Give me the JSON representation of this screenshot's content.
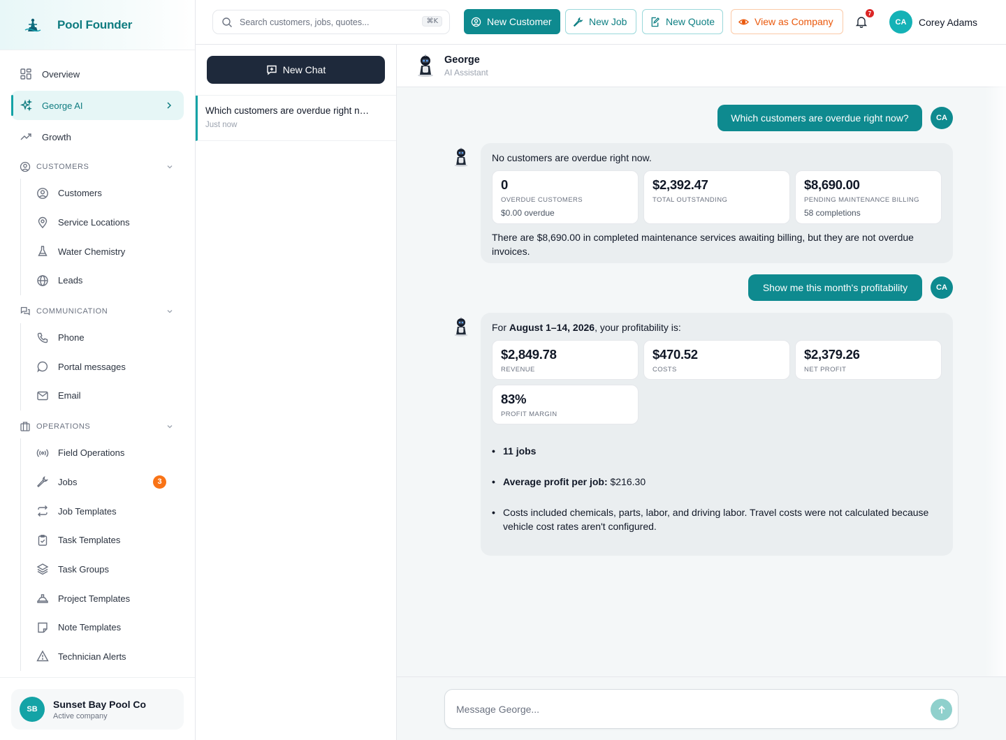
{
  "brand": {
    "name": "Pool Founder"
  },
  "sidebar": {
    "top_items": [
      {
        "label": "Overview",
        "icon": "grid-icon"
      },
      {
        "label": "George AI",
        "icon": "sparkles-icon",
        "active": true
      },
      {
        "label": "Growth",
        "icon": "trending-up-icon"
      }
    ],
    "sections": [
      {
        "title": "CUSTOMERS",
        "items": [
          {
            "label": "Customers"
          },
          {
            "label": "Service Locations"
          },
          {
            "label": "Water Chemistry"
          },
          {
            "label": "Leads"
          }
        ]
      },
      {
        "title": "COMMUNICATION",
        "items": [
          {
            "label": "Phone"
          },
          {
            "label": "Portal messages"
          },
          {
            "label": "Email"
          }
        ]
      },
      {
        "title": "OPERATIONS",
        "items": [
          {
            "label": "Field Operations"
          },
          {
            "label": "Jobs",
            "badge": "3"
          },
          {
            "label": "Job Templates"
          },
          {
            "label": "Task Templates"
          },
          {
            "label": "Task Groups"
          },
          {
            "label": "Project Templates"
          },
          {
            "label": "Note Templates"
          },
          {
            "label": "Technician Alerts"
          }
        ]
      }
    ],
    "company": {
      "initials": "SB",
      "name": "Sunset Bay Pool Co",
      "status": "Active company"
    }
  },
  "topbar": {
    "search_placeholder": "Search customers, jobs, quotes...",
    "search_shortcut": "⌘K",
    "new_customer": "New Customer",
    "new_job": "New Job",
    "new_quote": "New Quote",
    "view_as_company": "View as Company",
    "notification_count": "7",
    "user": {
      "initials": "CA",
      "name": "Corey Adams"
    }
  },
  "chatlist": {
    "new_chat": "New Chat",
    "conversations": [
      {
        "title": "Which customers are overdue right now?",
        "time": "Just now"
      }
    ]
  },
  "chat": {
    "assistant_name": "George",
    "assistant_role": "AI Assistant",
    "user_initials": "CA",
    "messages": [
      {
        "role": "user",
        "text": "Which customers are overdue right now?"
      },
      {
        "role": "assistant",
        "lead": "No customers are overdue right now.",
        "cards": [
          {
            "value": "0",
            "label": "OVERDUE CUSTOMERS",
            "sub": "$0.00 overdue"
          },
          {
            "value": "$2,392.47",
            "label": "TOTAL OUTSTANDING",
            "sub": ""
          },
          {
            "value": "$8,690.00",
            "label": "PENDING MAINTENANCE BILLING",
            "sub": "58 completions"
          }
        ],
        "text": "There are $8,690.00 in completed maintenance services awaiting billing, but they are not overdue invoices."
      },
      {
        "role": "user",
        "text": "Show me this month's profitability"
      },
      {
        "role": "assistant",
        "lead_prefix": "For ",
        "lead_bold": "August 1–14, 2026",
        "lead_suffix": ", your profitability is:",
        "cards": [
          {
            "value": "$2,849.78",
            "label": "REVENUE"
          },
          {
            "value": "$470.52",
            "label": "COSTS"
          },
          {
            "value": "$2,379.26",
            "label": "NET PROFIT"
          },
          {
            "value": "83%",
            "label": "PROFIT MARGIN"
          }
        ],
        "bullets": [
          {
            "bold": "11 jobs",
            "text": ""
          },
          {
            "bold": "Average profit per job:",
            "text": " $216.30"
          },
          {
            "bold": "",
            "text": "Costs included chemicals, parts, labor, and driving labor. Travel costs were not calculated because vehicle cost rates aren't configured."
          }
        ]
      }
    ],
    "composer_placeholder": "Message George..."
  },
  "colors": {
    "accent": "#0e8a8f",
    "brand_text": "#0f7c80",
    "warn": "#ea580c",
    "badge": "#f97316",
    "dark_button": "#1e293b"
  }
}
